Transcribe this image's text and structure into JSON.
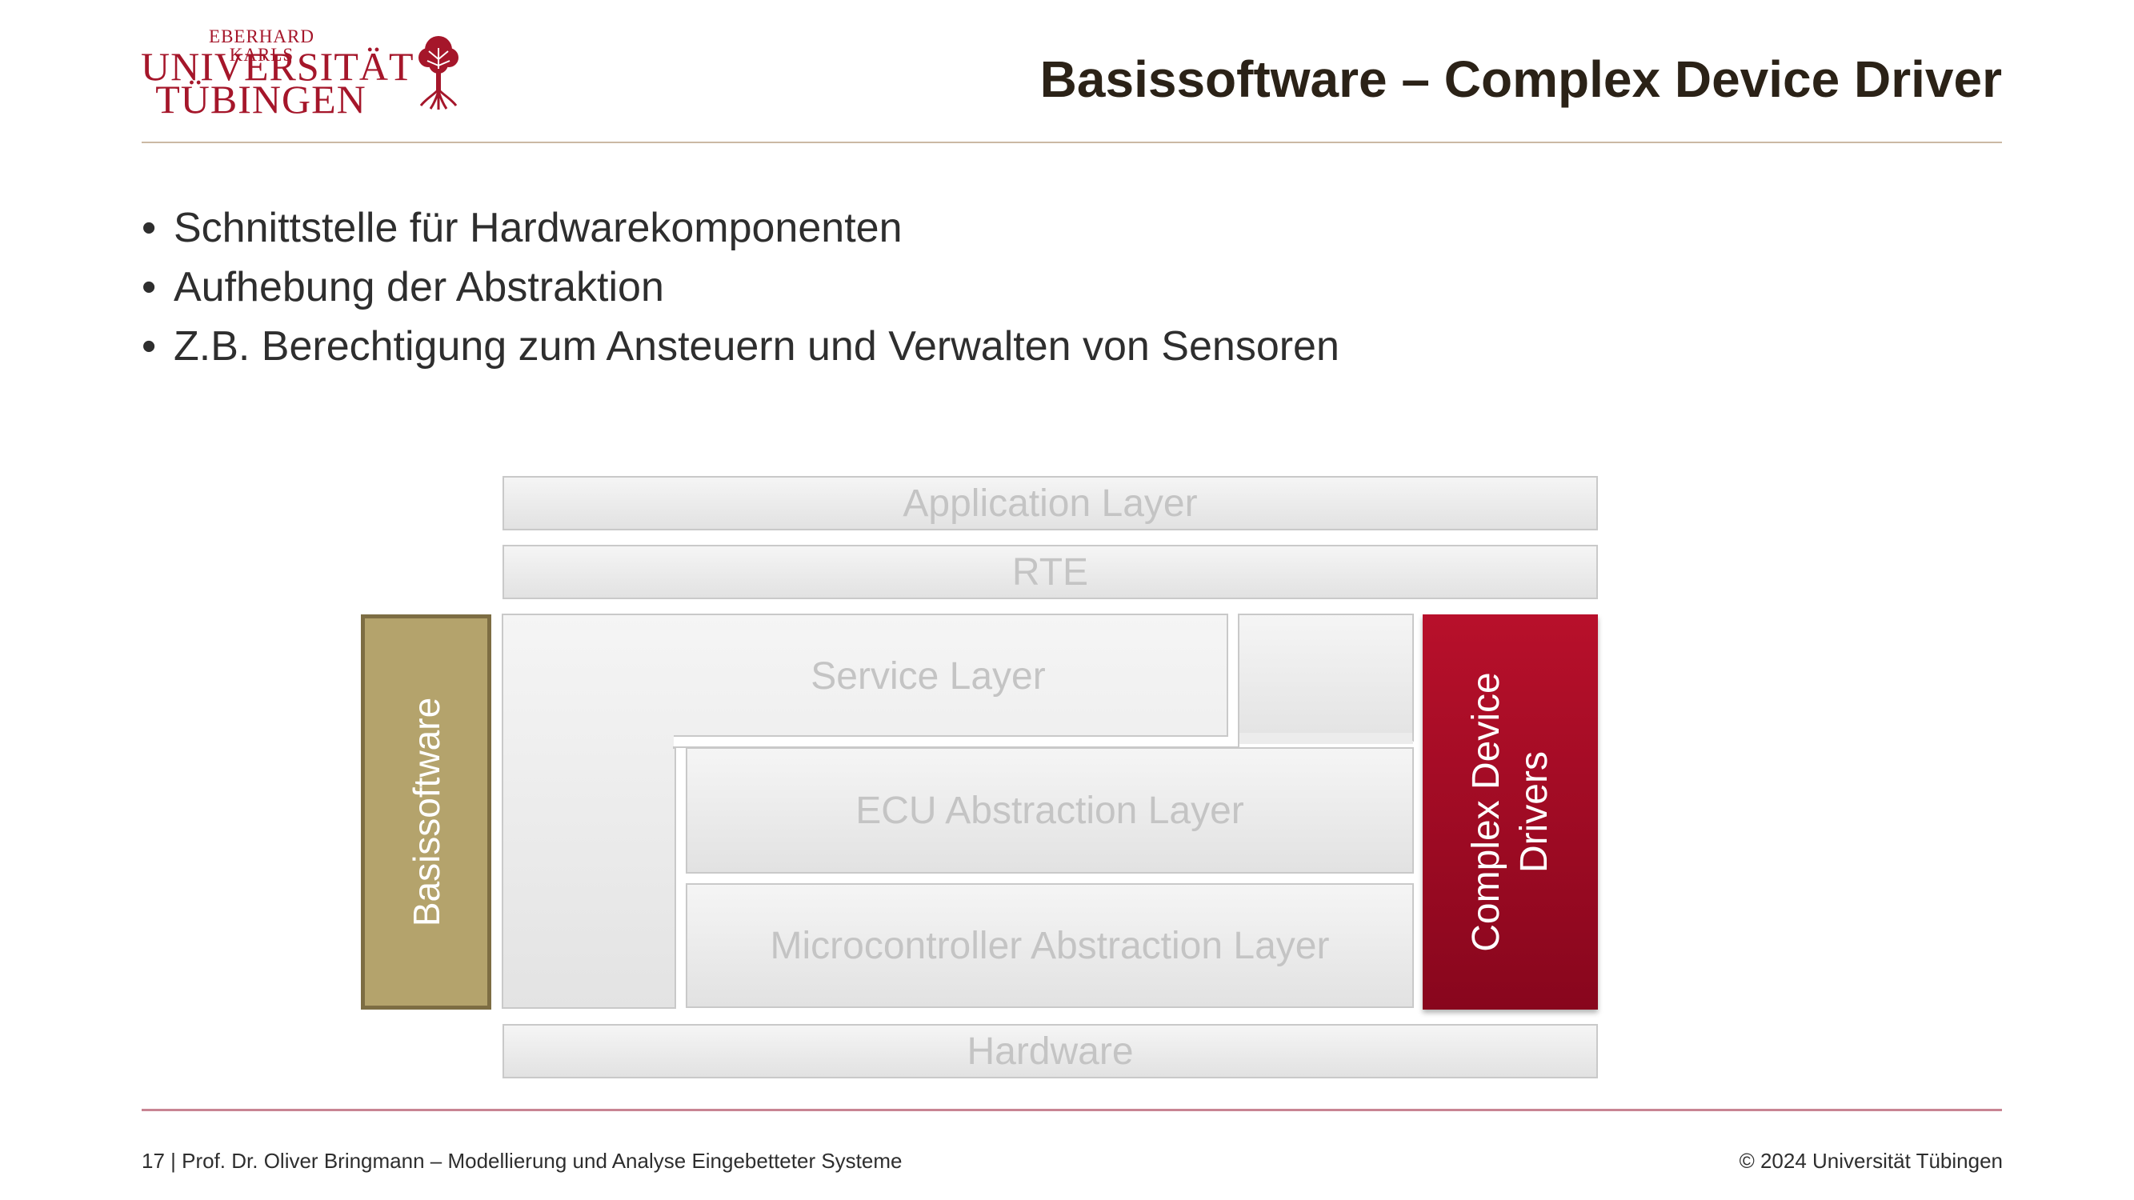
{
  "logo": {
    "line1": "EBERHARD KARLS",
    "line2": "UNIVERSITÄT",
    "line3": "TÜBINGEN",
    "icon": "tree-icon",
    "color": "#a5162a"
  },
  "title": "Basissoftware – Complex Device Driver",
  "bullets": [
    "Schnittstelle für Hardwarekomponenten",
    "Aufhebung der Abstraktion",
    "Z.B. Berechtigung zum Ansteuern und Verwalten von Sensoren"
  ],
  "diagram": {
    "application_layer": "Application Layer",
    "rte": "RTE",
    "service_layer": "Service Layer",
    "ecu_abstraction_layer": "ECU Abstraction Layer",
    "microcontroller_abstraction_layer": "Microcontroller Abstraction Layer",
    "hardware": "Hardware",
    "basissoftware": "Basissoftware",
    "complex_device_drivers_line1": "Complex Device",
    "complex_device_drivers_line2": "Drivers",
    "colors": {
      "basissoftware": "#b4a36c",
      "complex_device_drivers": "#a50b24",
      "layer_text": "#c4c4c4"
    }
  },
  "footer": {
    "left": "17 | Prof. Dr. Oliver Bringmann – Modellierung und Analyse Eingebetteter Systeme",
    "right": "© 2024 Universität Tübingen"
  }
}
